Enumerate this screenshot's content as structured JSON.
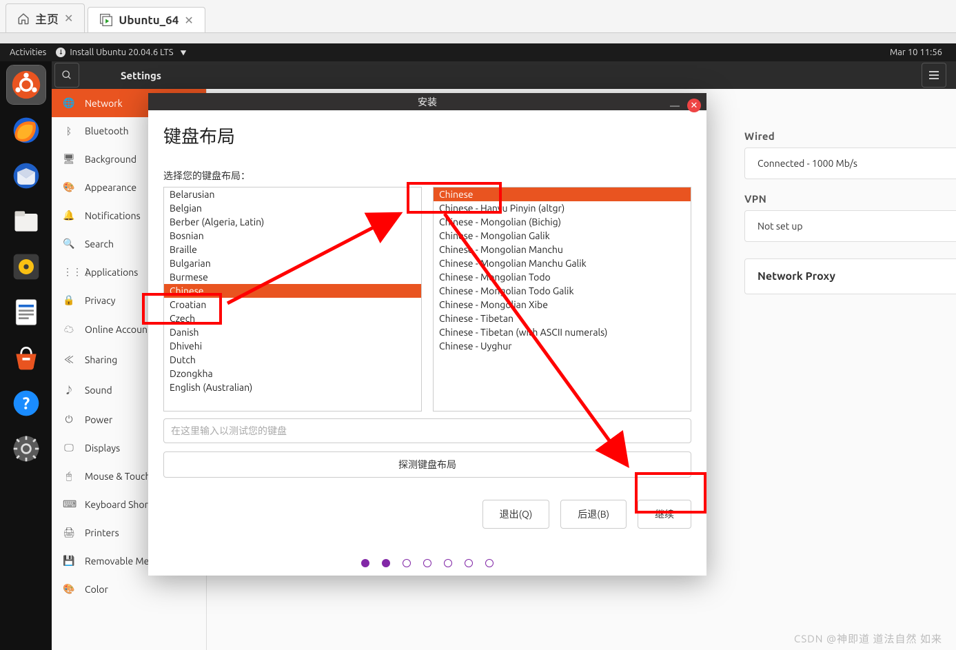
{
  "vm_tabs": {
    "home": "主页",
    "ubuntu": "Ubuntu_64"
  },
  "gnome": {
    "activities": "Activities",
    "install_label": "Install Ubuntu 20.04.6 LTS",
    "clock": "Mar 10  11:56"
  },
  "settings": {
    "app_title": "Settings",
    "categories": [
      "Network",
      "Bluetooth",
      "Background",
      "Appearance",
      "Notifications",
      "Search",
      "Applications",
      "Privacy",
      "Online Accounts",
      "Sharing",
      "Sound",
      "Power",
      "Displays",
      "Mouse & Touchpad",
      "Keyboard Shortcuts",
      "Printers",
      "Removable Media",
      "Color"
    ],
    "active_index": 0,
    "icons": [
      "🌐",
      "ᛒ",
      "🖥",
      "🎨",
      "🔔",
      "🔍",
      "⋮⋮⋮",
      "🔒",
      "☁",
      "≪",
      "♪",
      "⏻",
      "🖵",
      "🖱",
      "⌨",
      "🖨",
      "💾",
      "🎨"
    ]
  },
  "network_panel": {
    "wired_heading": "Wired",
    "wired_status": "Connected - 1000 Mb/s",
    "vpn_heading": "VPN",
    "vpn_status": "Not set up",
    "proxy_heading": "Network Proxy"
  },
  "installer": {
    "window_title": "安装",
    "heading": "键盘布局",
    "choose_label": "选择您的键盘布局：",
    "left_list": [
      "Belarusian",
      "Belgian",
      "Berber (Algeria, Latin)",
      "Bosnian",
      "Braille",
      "Bulgarian",
      "Burmese",
      "Chinese",
      "Croatian",
      "Czech",
      "Danish",
      "Dhivehi",
      "Dutch",
      "Dzongkha",
      "English (Australian)"
    ],
    "left_selected": "Chinese",
    "right_list": [
      "Chinese",
      "Chinese - Hanyu Pinyin (altgr)",
      "Chinese - Mongolian (Bichig)",
      "Chinese - Mongolian Galik",
      "Chinese - Mongolian Manchu",
      "Chinese - Mongolian Manchu Galik",
      "Chinese - Mongolian Todo",
      "Chinese - Mongolian Todo Galik",
      "Chinese - Mongolian Xibe",
      "Chinese - Tibetan",
      "Chinese - Tibetan (with ASCII numerals)",
      "Chinese - Uyghur"
    ],
    "right_selected": "Chinese",
    "test_placeholder": "在这里输入以测试您的键盘",
    "detect_button": "探测键盘布局",
    "quit_button": "退出(Q)",
    "back_button": "后退(B)",
    "continue_button": "继续"
  },
  "watermark": "CSDN @神即道 道法自然 如来"
}
